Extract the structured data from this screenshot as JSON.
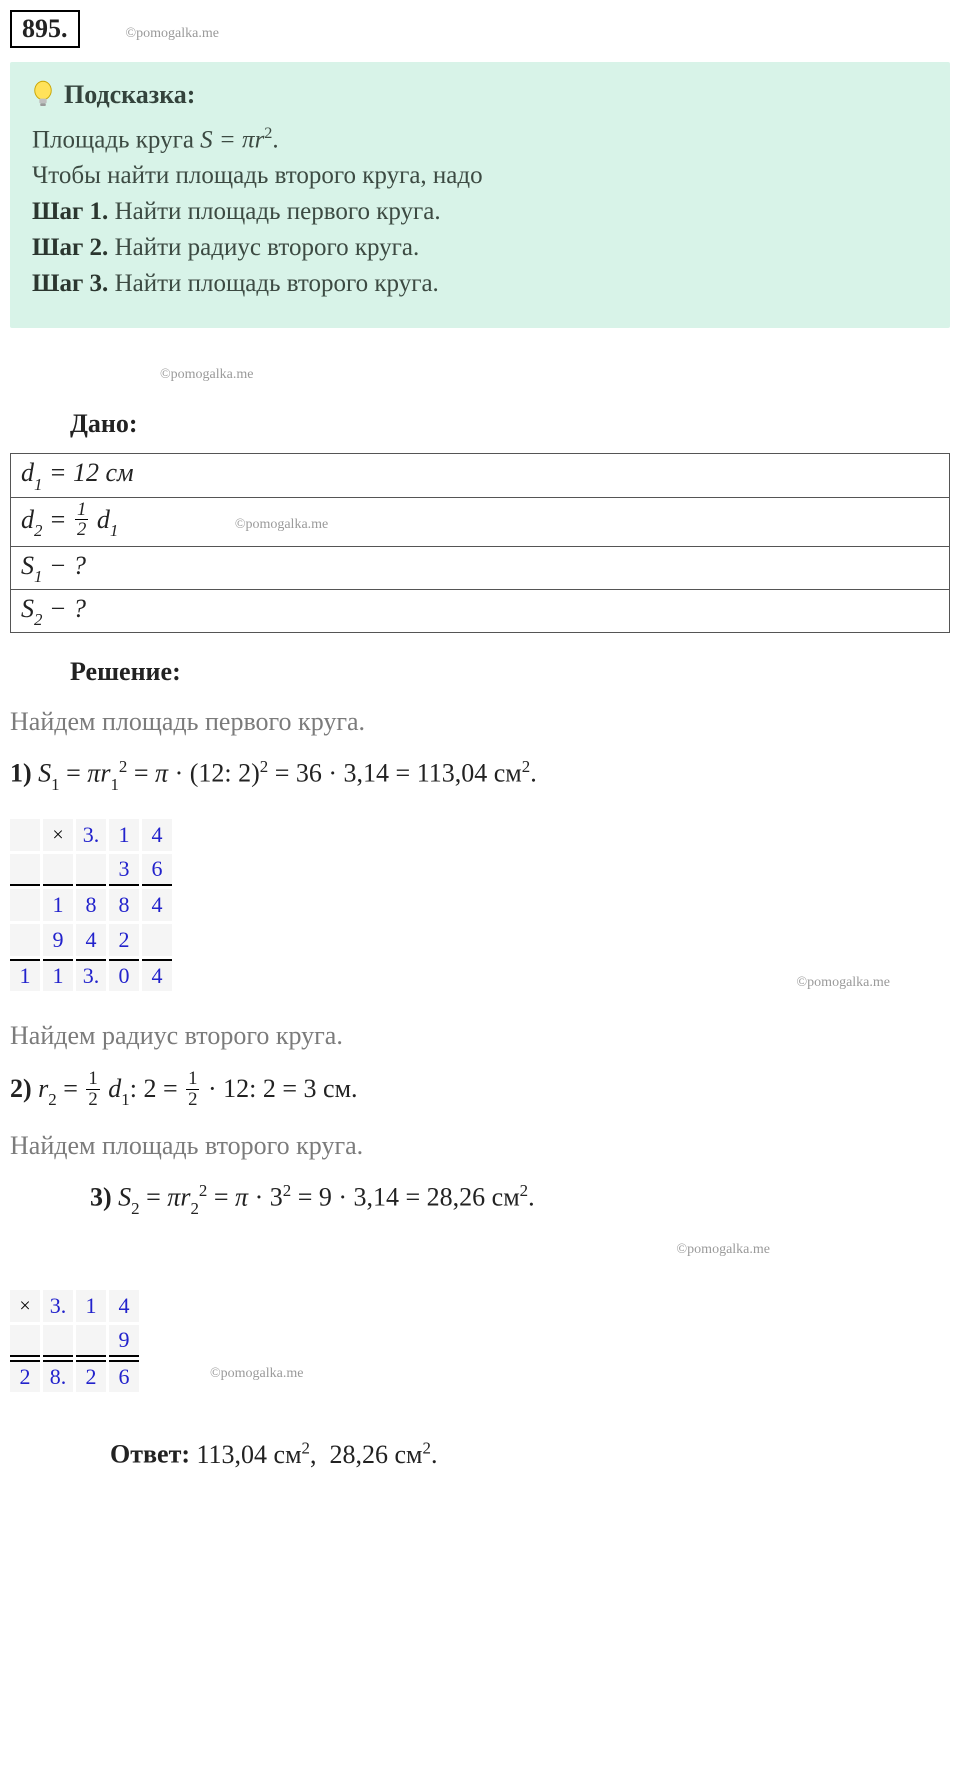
{
  "problem_number": "895.",
  "watermark": "©pomogalka.me",
  "hint": {
    "title": "Подсказка:",
    "formula": "Площадь круга S = πr².",
    "intro": "Чтобы найти площадь второго круга, надо",
    "steps": [
      {
        "label": "Шаг 1.",
        "text": " Найти  площадь первого круга."
      },
      {
        "label": "Шаг 2.",
        "text": " Найти радиус второго круга."
      },
      {
        "label": "Шаг 3.",
        "text": " Найти площадь второго круга."
      }
    ]
  },
  "given_label": "Дано:",
  "given": [
    {
      "html": "d<sub>1</sub> = 12 см"
    },
    {
      "html": "d<sub>2</sub> = ½ d<sub>1</sub>"
    },
    {
      "html": "S<sub>1</sub> − ?"
    },
    {
      "html": "S<sub>2</sub> − ?"
    }
  ],
  "solution_label": "Решение:",
  "text_find_s1": "Найдем площадь первого круга.",
  "eq1": "S₁ = πr₁² = π · (12: 2)² = 36 · 3,14 = 113,04 см².",
  "text_find_r2": "Найдем радиус второго круга.",
  "eq2": "r₂ = ½ d₁: 2 = ½ · 12: 2 = 3 см.",
  "text_find_s2": "Найдем площадь второго круга.",
  "eq3": "S₂ = πr₂² = π · 3² = 9 · 3,14 = 28,26 см².",
  "calc1": {
    "rows": [
      [
        "",
        "×",
        "3.",
        "1",
        "4"
      ],
      [
        "",
        "",
        "",
        "3",
        "6"
      ],
      [
        "",
        "1",
        "8",
        "8",
        "4"
      ],
      [
        "",
        "9",
        "4",
        "2",
        ""
      ],
      [
        "1",
        "1",
        "3.",
        "0",
        "4"
      ]
    ],
    "underline_after_row": 1,
    "topline_at_row": 4
  },
  "calc2": {
    "rows": [
      [
        "×",
        "3.",
        "1",
        "4"
      ],
      [
        "",
        "",
        "",
        "9"
      ],
      [
        "2",
        "8.",
        "2",
        "6"
      ]
    ],
    "underline_after_row": 1,
    "topline_at_row": 2
  },
  "answer_label": "Ответ:",
  "answer": " 113,04 см²,  28,26 см²."
}
